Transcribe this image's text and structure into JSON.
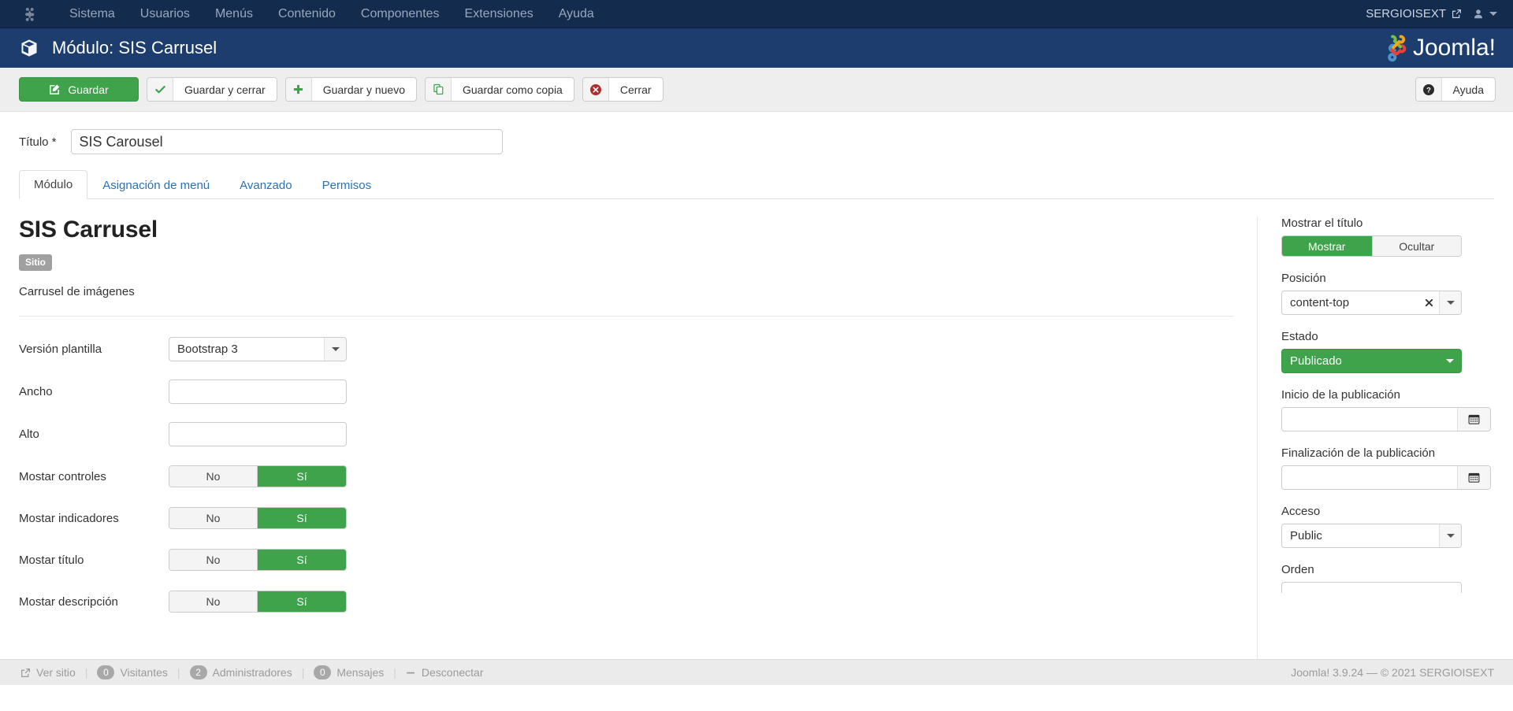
{
  "topbar": {
    "logo_icon": "joomla-mark-icon",
    "menu": [
      {
        "label": "Sistema"
      },
      {
        "label": "Usuarios"
      },
      {
        "label": "Menús"
      },
      {
        "label": "Contenido"
      },
      {
        "label": "Componentes"
      },
      {
        "label": "Extensiones"
      },
      {
        "label": "Ayuda"
      }
    ],
    "site_name": "SERGIOISEXT",
    "site_icon": "external-link-icon",
    "user_icon": "user-icon",
    "user_caret_icon": "chevron-down-icon"
  },
  "subhead": {
    "icon": "cube-icon",
    "title": "Módulo: SIS Carrusel",
    "brand": "Joomla!"
  },
  "toolbar": {
    "save": {
      "label": "Guardar",
      "icon": "save-pencil-icon"
    },
    "save_close": {
      "label": "Guardar y cerrar",
      "icon": "check-icon"
    },
    "save_new": {
      "label": "Guardar y nuevo",
      "icon": "plus-icon"
    },
    "save_copy": {
      "label": "Guardar como copia",
      "icon": "copy-icon"
    },
    "close": {
      "label": "Cerrar",
      "icon": "close-circle-icon"
    },
    "help": {
      "label": "Ayuda",
      "icon": "question-circle-icon"
    }
  },
  "form": {
    "title_label": "Título *",
    "title_value": "SIS Carousel",
    "title_placeholder": ""
  },
  "tabs": [
    {
      "label": "Módulo",
      "active": true
    },
    {
      "label": "Asignación de menú",
      "active": false
    },
    {
      "label": "Avanzado",
      "active": false
    },
    {
      "label": "Permisos",
      "active": false
    }
  ],
  "module": {
    "heading": "SIS Carrusel",
    "badge": "Sitio",
    "description": "Carrusel de imágenes"
  },
  "left_fields": [
    {
      "label": "Versión plantilla",
      "type": "select",
      "value": "Bootstrap 3",
      "name": "version-plantilla"
    },
    {
      "label": "Ancho",
      "type": "text",
      "value": "",
      "name": "ancho"
    },
    {
      "label": "Alto",
      "type": "text",
      "value": "",
      "name": "alto"
    },
    {
      "label": "Mostar controles",
      "type": "toggle",
      "off_label": "No",
      "on_label": "Sí",
      "selected": "on",
      "name": "mostar-controles"
    },
    {
      "label": "Mostar indicadores",
      "type": "toggle",
      "off_label": "No",
      "on_label": "Sí",
      "selected": "on",
      "name": "mostar-indicadores"
    },
    {
      "label": "Mostar título",
      "type": "toggle",
      "off_label": "No",
      "on_label": "Sí",
      "selected": "on",
      "name": "mostar-titulo"
    },
    {
      "label": "Mostar descripción",
      "type": "toggle",
      "off_label": "No",
      "on_label": "Sí",
      "selected": "on",
      "name": "mostar-descripcion"
    }
  ],
  "right_panel": {
    "show_title": {
      "label": "Mostrar el título",
      "show": "Mostrar",
      "hide": "Ocultar",
      "selected": "show"
    },
    "position": {
      "label": "Posición",
      "value": "content-top",
      "clear_icon": "clear-x-icon",
      "arrow_icon": "chevron-down-icon"
    },
    "status": {
      "label": "Estado",
      "value": "Publicado",
      "arrow_icon": "chevron-down-icon"
    },
    "publish_start": {
      "label": "Inicio de la publicación",
      "value": "",
      "icon": "calendar-icon"
    },
    "publish_end": {
      "label": "Finalización de la publicación",
      "value": "",
      "icon": "calendar-icon"
    },
    "access": {
      "label": "Acceso",
      "value": "Public",
      "arrow_icon": "chevron-down-icon"
    },
    "order": {
      "label": "Orden"
    }
  },
  "statusbar": {
    "view_site": {
      "label": "Ver sitio",
      "icon": "external-link-icon"
    },
    "visitors": {
      "count": "0",
      "label": "Visitantes"
    },
    "admins": {
      "count": "2",
      "label": "Administradores"
    },
    "messages": {
      "count": "0",
      "label": "Mensajes"
    },
    "logout": {
      "label": "Desconectar",
      "icon": "minus-icon"
    },
    "copyright": "Joomla! 3.9.24  —  © 2021 SERGIOISEXT"
  },
  "colors": {
    "topbar_bg": "#132b4c",
    "subhead_bg": "#1c3d6e",
    "accent_green": "#3ea34b",
    "link_blue": "#2a72b5"
  }
}
